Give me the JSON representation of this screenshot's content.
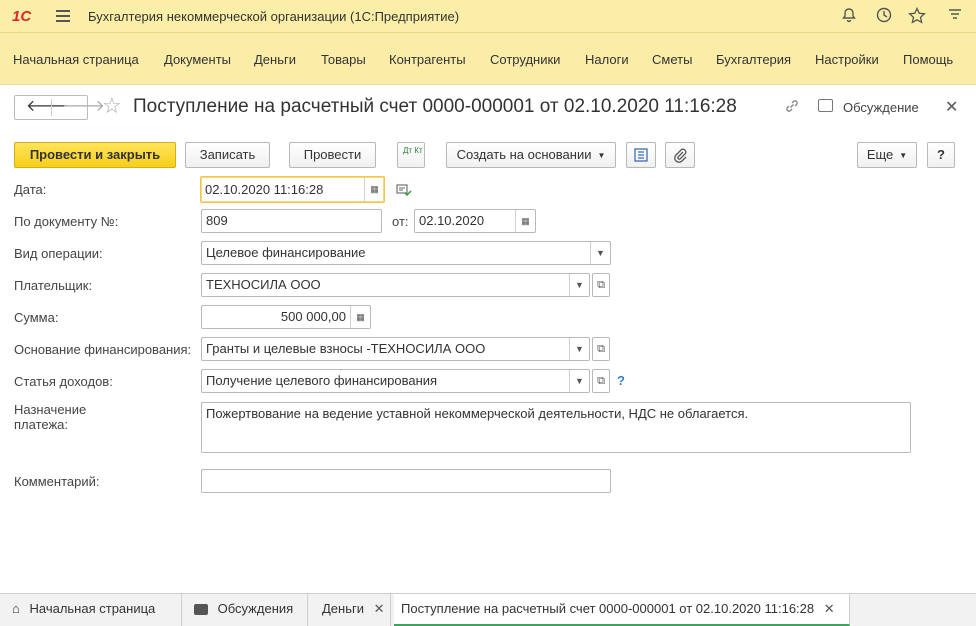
{
  "app": {
    "logo": "1С",
    "title": "Бухгалтерия некоммерческой организации  (1С:Предприятие)"
  },
  "menu": [
    "Начальная страница",
    "Документы",
    "Деньги",
    "Товары",
    "Контрагенты",
    "Сотрудники",
    "Налоги",
    "Сметы",
    "Бухгалтерия",
    "Настройки",
    "Помощь"
  ],
  "document": {
    "title": "Поступление на расчетный счет 0000-000001 от 02.10.2020 11:16:28",
    "discussion_label": "Обсуждение"
  },
  "toolbar": {
    "post_close": "Провести и закрыть",
    "save": "Записать",
    "post": "Провести",
    "dt_kt": "Дт Кт",
    "create_based": "Создать на основании",
    "more": "Еще",
    "help": "?"
  },
  "form": {
    "date_label": "Дата:",
    "date_value": "02.10.2020 11:16:28",
    "docnum_label": "По документу №:",
    "docnum_value": "809",
    "from_label": "от:",
    "from_value": "02.10.2020",
    "operation_label": "Вид операции:",
    "operation_value": "Целевое финансирование",
    "payer_label": "Плательщик:",
    "payer_value": "ТЕХНОСИЛА  ООО",
    "sum_label": "Сумма:",
    "sum_value": "500 000,00",
    "basis_label": "Основание финансирования:",
    "basis_value": "Гранты и целевые взносы -ТЕХНОСИЛА ООО",
    "income_label": "Статья доходов:",
    "income_value": "Получение целевого финансирования",
    "income_help": "?",
    "purpose_label_1": "Назначение",
    "purpose_label_2": "платежа:",
    "purpose_value": "Пожертвование на ведение уставной некоммерческой деятельности, НДС не облагается.",
    "comment_label": "Комментарий:",
    "comment_value": ""
  },
  "tabs": [
    {
      "label": "Начальная страница"
    },
    {
      "label": "Обсуждения"
    },
    {
      "label": "Деньги"
    },
    {
      "label": "Поступление на расчетный счет 0000-000001 от 02.10.2020 11:16:28"
    }
  ],
  "colors": {
    "titlebar": "#fbeea6",
    "menubar": "#fbeda8",
    "primary_button": "#f6cf1a",
    "focus_border": "#f3c648",
    "active_tab_underline": "#3aa55d",
    "logo": "#d8282b"
  },
  "icons": [
    "menu-icon",
    "bell-icon",
    "history-icon",
    "star-icon",
    "settings-icon",
    "back-arrow-icon",
    "forward-arrow-icon",
    "favorite-star-icon",
    "link-icon",
    "discussion-icon",
    "close-icon",
    "structure-icon",
    "attachment-icon",
    "calendar-icon",
    "history-check-icon",
    "dropdown-icon",
    "open-icon",
    "calculator-icon",
    "home-icon",
    "chat-icon"
  ]
}
